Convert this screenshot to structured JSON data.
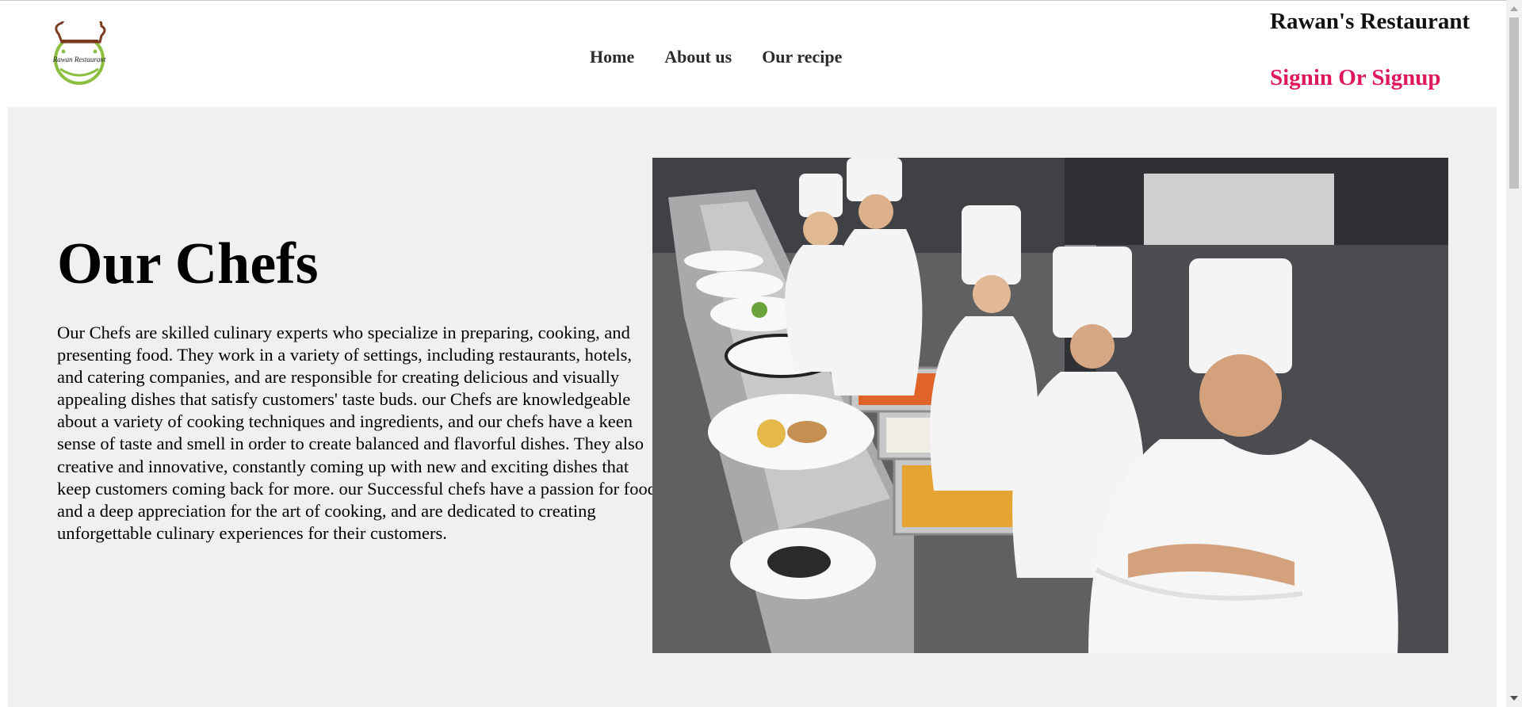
{
  "header": {
    "brand": "Rawan's Restaurant",
    "logo_text": "Rawan Restaurant",
    "nav": [
      {
        "label": "Home"
      },
      {
        "label": "About us"
      },
      {
        "label": "Our recipe"
      }
    ],
    "signin_label": "Signin Or Signup"
  },
  "main": {
    "title": "Our Chefs",
    "description": "Our Chefs are skilled culinary experts who specialize in preparing, cooking, and presenting food. They work in a variety of settings, including restaurants, hotels, and catering companies, and are responsible for creating delicious and visually appealing dishes that satisfy customers' taste buds. our Chefs are knowledgeable about a variety of cooking techniques and ingredients, and our chefs have a keen sense of taste and smell in order to create balanced and flavorful dishes. They also creative and innovative, constantly coming up with new and exciting dishes that keep customers coming back for more. our Successful chefs have a passion for food and a deep appreciation for the art of cooking, and are dedicated to creating unforgettable culinary experiences for their customers."
  },
  "colors": {
    "accent": "#e0175e",
    "page_background": "#f0f0f0",
    "header_background": "#ffffff",
    "logo_green": "#8cbf3f",
    "logo_brown": "#7a3b1e"
  },
  "icons": {
    "logo": "chef-hat-logo-icon",
    "scroll_up": "scroll-up-arrow-icon",
    "scroll_down": "scroll-down-arrow-icon"
  }
}
